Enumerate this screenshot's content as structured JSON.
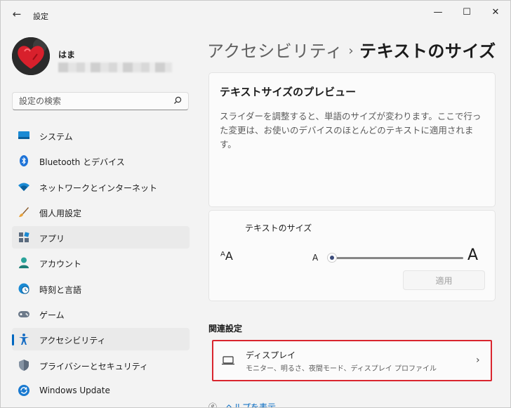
{
  "app": {
    "title": "設定",
    "back_glyph": "←",
    "window_controls": {
      "minimize": "—",
      "maximize": "☐",
      "close": "✕"
    }
  },
  "profile": {
    "name": "はま"
  },
  "search": {
    "placeholder": "設定の検索"
  },
  "sidebar": {
    "items": [
      {
        "label": "システム",
        "icon": "monitor-icon"
      },
      {
        "label": "Bluetooth とデバイス",
        "icon": "bluetooth-icon"
      },
      {
        "label": "ネットワークとインターネット",
        "icon": "wifi-icon"
      },
      {
        "label": "個人用設定",
        "icon": "paintbrush-icon"
      },
      {
        "label": "アプリ",
        "icon": "apps-icon",
        "highlighted": true
      },
      {
        "label": "アカウント",
        "icon": "person-icon"
      },
      {
        "label": "時刻と言語",
        "icon": "globe-clock-icon"
      },
      {
        "label": "ゲーム",
        "icon": "gamepad-icon"
      },
      {
        "label": "アクセシビリティ",
        "icon": "accessibility-icon",
        "selected": true
      },
      {
        "label": "プライバシーとセキュリティ",
        "icon": "shield-icon"
      },
      {
        "label": "Windows Update",
        "icon": "update-icon"
      }
    ]
  },
  "header": {
    "breadcrumb_parent": "アクセシビリティ",
    "breadcrumb_sep": "›",
    "breadcrumb_current": "テキストのサイズ"
  },
  "preview": {
    "title": "テキストサイズのプレビュー",
    "text": "スライダーを調整すると、単語のサイズが変わります。ここで行った変更は、お使いのデバイスのほとんどのテキストに適用されます。"
  },
  "text_size": {
    "title": "テキストのサイズ",
    "aa_glyph": "ᴬA",
    "small_label": "A",
    "large_label": "A",
    "slider_percent": 0,
    "apply_label": "適用"
  },
  "related": {
    "heading": "関連設定",
    "display": {
      "title": "ディスプレイ",
      "subtitle": "モニター、明るさ、夜間モード、ディスプレイ プロファイル",
      "chevron": "›"
    },
    "help": {
      "label": "ヘルプを表示"
    }
  },
  "colors": {
    "accent": "#0067c0",
    "highlight_border": "#d9252e",
    "background": "#f3f3f3"
  }
}
